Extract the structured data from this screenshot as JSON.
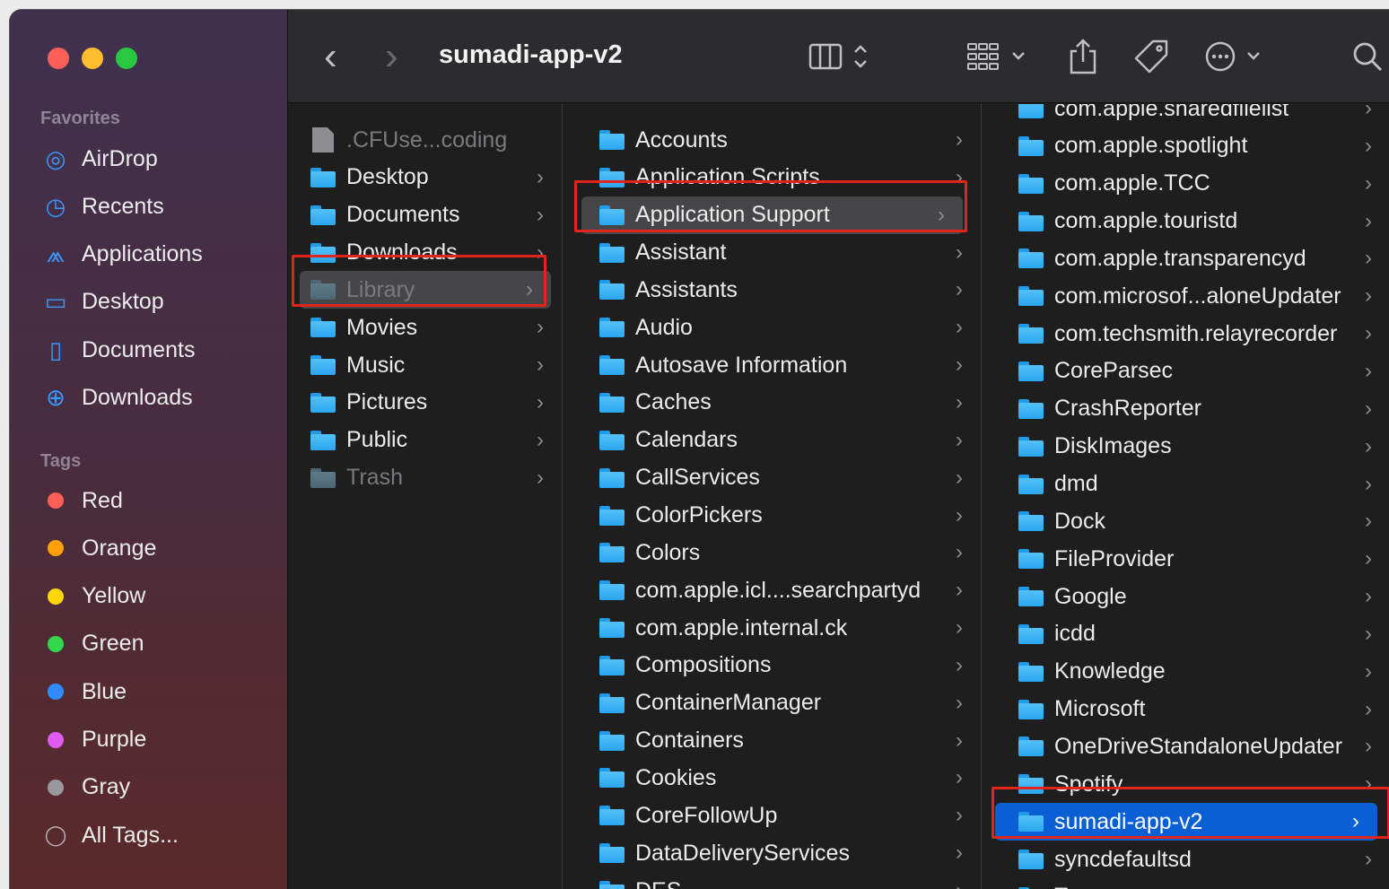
{
  "window": {
    "title": "sumadi-app-v2"
  },
  "colors": {
    "accent": "#0a5fd4",
    "highlight": "#e3241b"
  },
  "sidebar": {
    "favorites_label": "Favorites",
    "favorites": [
      {
        "label": "AirDrop",
        "icon": "airdrop-icon"
      },
      {
        "label": "Recents",
        "icon": "clock-icon"
      },
      {
        "label": "Applications",
        "icon": "applications-icon"
      },
      {
        "label": "Desktop",
        "icon": "desktop-icon"
      },
      {
        "label": "Documents",
        "icon": "document-icon"
      },
      {
        "label": "Downloads",
        "icon": "download-icon"
      }
    ],
    "tags_label": "Tags",
    "tags": [
      {
        "label": "Red",
        "color": "#fe5f57"
      },
      {
        "label": "Orange",
        "color": "#ff9f0a"
      },
      {
        "label": "Yellow",
        "color": "#ffd60a"
      },
      {
        "label": "Green",
        "color": "#32d74b"
      },
      {
        "label": "Blue",
        "color": "#2f8cff"
      },
      {
        "label": "Purple",
        "color": "#e05cf0"
      },
      {
        "label": "Gray",
        "color": "#98989d"
      }
    ],
    "all_tags": "All Tags..."
  },
  "toolbar": {
    "back": "‹",
    "forward": "›"
  },
  "columns": {
    "home": [
      {
        "label": ".CFUse...coding",
        "kind": "file",
        "dim": true
      },
      {
        "label": "Desktop"
      },
      {
        "label": "Documents"
      },
      {
        "label": "Downloads"
      },
      {
        "label": "Library",
        "dim": true,
        "selected": true
      },
      {
        "label": "Movies"
      },
      {
        "label": "Music"
      },
      {
        "label": "Pictures"
      },
      {
        "label": "Public"
      },
      {
        "label": "Trash",
        "dim": true
      }
    ],
    "library": [
      {
        "label": "Accounts"
      },
      {
        "label": "Application Scripts"
      },
      {
        "label": "Application Support",
        "selected": true
      },
      {
        "label": "Assistant"
      },
      {
        "label": "Assistants"
      },
      {
        "label": "Audio"
      },
      {
        "label": "Autosave Information"
      },
      {
        "label": "Caches"
      },
      {
        "label": "Calendars"
      },
      {
        "label": "CallServices"
      },
      {
        "label": "ColorPickers"
      },
      {
        "label": "Colors"
      },
      {
        "label": "com.apple.icl....searchpartyd"
      },
      {
        "label": "com.apple.internal.ck"
      },
      {
        "label": "Compositions"
      },
      {
        "label": "ContainerManager"
      },
      {
        "label": "Containers"
      },
      {
        "label": "Cookies"
      },
      {
        "label": "CoreFollowUp"
      },
      {
        "label": "DataDeliveryServices"
      },
      {
        "label": "DES"
      }
    ],
    "app_support": [
      {
        "label": "com.apple.sharedfilelist"
      },
      {
        "label": "com.apple.spotlight"
      },
      {
        "label": "com.apple.TCC"
      },
      {
        "label": "com.apple.touristd"
      },
      {
        "label": "com.apple.transparencyd"
      },
      {
        "label": "com.microsof...aloneUpdater"
      },
      {
        "label": "com.techsmith.relayrecorder"
      },
      {
        "label": "CoreParsec"
      },
      {
        "label": "CrashReporter"
      },
      {
        "label": "DiskImages"
      },
      {
        "label": "dmd"
      },
      {
        "label": "Dock"
      },
      {
        "label": "FileProvider"
      },
      {
        "label": "Google"
      },
      {
        "label": "icdd"
      },
      {
        "label": "Knowledge"
      },
      {
        "label": "Microsoft"
      },
      {
        "label": "OneDriveStandaloneUpdater"
      },
      {
        "label": "Spotify"
      },
      {
        "label": "sumadi-app-v2",
        "selected": true
      },
      {
        "label": "syncdefaultsd"
      },
      {
        "label": "Teams"
      }
    ]
  }
}
